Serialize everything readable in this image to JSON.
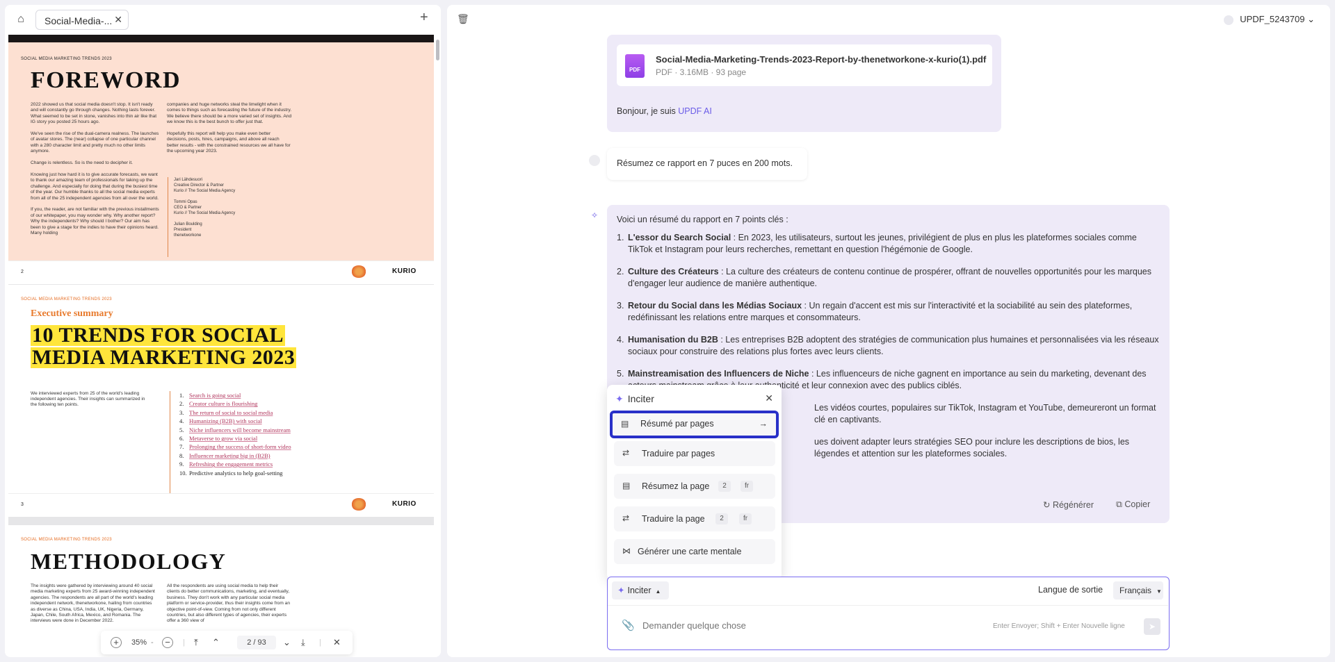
{
  "left_panel": {
    "tab_label": "Social-Media-...",
    "zoom": "35%",
    "page_current": "2",
    "page_total": "93"
  },
  "pdf": {
    "page1": {
      "runner": "SOCIAL MEDIA MARKETING TRENDS 2023",
      "title": "FOREWORD",
      "col1": "2022 showed us that social media doesn't stop. It isn't ready and will constantly go through changes. Nothing lasts forever. What seemed to be set in stone, vanishes into thin air like that IG story you posted 25 hours ago.\n\nWe've seen the rise of the dual-camera realness. The launches of avatar stores. The (near) collapse of one particular channel with a 280 character limit and pretty much no other limits anymore.\n\nChange is relentless. So is the need to decipher it.\n\nKnowing just how hard it is to give accurate forecasts, we want to thank our amazing team of professionals for taking up the challenge. And especially for doing that during the busiest time of the year. Our humble thanks to all the social media experts from all of the 25 independent agencies from all over the world.\n\nIf you, the reader, are not familiar with the previous installments of our whitepaper, you may wonder why. Why another report? Why the independents? Why should I bother? Our aim has been to give a stage for the indies to have their opinions heard. Many holding",
      "col2": "companies and huge networks steal the limelight when it comes to things such as forecasting the future of the industry. We believe there should be a more varied set of insights. And we know this is the best bunch to offer just that.\n\nHopefully this report will help you make even better decisions, posts, hires, campaigns, and above all reach better results - with the constrained resources we all have for the upcoming year 2023.",
      "signatures": "Jari Lähdesuori\nCreative Director & Partner\nKurio // The Social Media Agency\n\nTommi Opas\nCEO & Partner\nKurio // The Social Media Agency\n\nJulian Boulding\nPresident\nthenetworkone",
      "page_number": "2",
      "logo": "KURIO"
    },
    "page2": {
      "runner": "SOCIAL MEDIA MARKETING TRENDS 2023",
      "kicker": "Executive summary",
      "title_line1": "10 TRENDS FOR SOCIAL",
      "title_line2": "MEDIA MARKETING 2023",
      "intro": "We interviewed experts from 25 of the world's leading independent agencies. Their insights can summarized in the following ten points.",
      "trends": [
        {
          "n": "1.",
          "t": "Search is going social"
        },
        {
          "n": "2.",
          "t": "Creator culture is flourishing"
        },
        {
          "n": "3.",
          "t": "The return of social to social media"
        },
        {
          "n": "4.",
          "t": "Humanizing (B2B) with social"
        },
        {
          "n": "5.",
          "t": "Niche influencers will become mainstream"
        },
        {
          "n": "6.",
          "t": "Metaverse to grow via social"
        },
        {
          "n": "7.",
          "t": "Prolonging the success of short-form video"
        },
        {
          "n": "8.",
          "t": "Influencer marketing big in (B2B)"
        },
        {
          "n": "9.",
          "t": "Refreshing the engagement metrics"
        },
        {
          "n": "10.",
          "t": "Predictive analytics to help goal-setting"
        }
      ],
      "page_number": "3",
      "logo": "KURIO"
    },
    "page3": {
      "runner": "SOCIAL MEDIA MARKETING TRENDS 2023",
      "title": "METHODOLOGY",
      "col1": "The insights were gathered by interviewing around 40 social media marketing experts from 25 award-winning independent agencies. The respondents are all part of the world's leading independent network, thenetworkone, hailing from countries as diverse as China, USA, India, UK, Nigeria, Germany, Japan, Chile, South Africa, Mexico, and Romania. The interviews were done in December 2022.",
      "col2": "All the respondents are using social media to help their clients do better communications, marketing, and eventually, business. They don't work with any particular social media platform or service-provider, thus their insights come from an objective point-of-view. Coming from not only different countries, but also different types of agencies, their experts offer a 360 view of"
    }
  },
  "right_panel": {
    "user_name": "UPDF_5243709",
    "file": {
      "name": "Social-Media-Marketing-Trends-2023-Report-by-thenetworkone-x-kurio(1).pdf",
      "meta": "PDF · 3.16MB · 93 page",
      "icon_label": "PDF"
    },
    "greeting_prefix": "Bonjour, je suis ",
    "greeting_brand": "UPDF AI",
    "user_message": "Résumez ce rapport en 7 puces en 200 mots.",
    "ai_intro": "Voici un résumé du rapport en 7 points clés :",
    "points": [
      {
        "num": "1.",
        "bold": "L'essor du Search Social",
        "text": " : En 2023, les utilisateurs, surtout les jeunes, privilégient de plus en plus les plateformes sociales comme TikTok et Instagram pour leurs recherches, remettant en question l'hégémonie de Google."
      },
      {
        "num": "2.",
        "bold": "Culture des Créateurs",
        "text": " : La culture des créateurs de contenu continue de prospérer, offrant de nouvelles opportunités pour les marques d'engager leur audience de manière authentique."
      },
      {
        "num": "3.",
        "bold": "Retour du Social dans les Médias Sociaux",
        "text": " : Un regain d'accent est mis sur l'interactivité et la sociabilité au sein des plateformes, redéfinissant les relations entre marques et consommateurs."
      },
      {
        "num": "4.",
        "bold": "Humanisation du B2B",
        "text": " : Les entreprises B2B adoptent des stratégies de communication plus humaines et personnalisées via les réseaux sociaux pour construire des relations plus fortes avec leurs clients."
      },
      {
        "num": "5.",
        "bold": "Mainstreamisation des Influencers de Niche",
        "text": " : Les influenceurs de niche gagnent en importance au sein du marketing, devenant des acteurs mainstream grâce à leur authenticité et leur connexion avec des publics ciblés."
      },
      {
        "num": "6.",
        "bold": "",
        "text": "Les vidéos courtes, populaires sur TikTok, Instagram et YouTube, demeureront un format clé en captivants."
      },
      {
        "num": "7.",
        "bold": "",
        "text": "ues doivent adapter leurs stratégies SEO pour inclure les descriptions de bios, les légendes et attention sur les plateformes sociales."
      }
    ],
    "regenerate_label": "Régénérer",
    "copy_label": "Copier",
    "popup": {
      "title": "Inciter",
      "items": [
        {
          "label": "Résumé par pages",
          "arrow": "→"
        },
        {
          "label": "Traduire par pages"
        },
        {
          "label": "Résumez la page",
          "tag1": "2",
          "tag2": "fr"
        },
        {
          "label": "Traduire la page",
          "tag1": "2",
          "tag2": "fr"
        },
        {
          "label": "Générer une carte mentale"
        }
      ]
    },
    "composer": {
      "prompt_button": "Inciter",
      "output_lang_label": "Langue de sortie",
      "output_lang_value": "Français",
      "placeholder": "Demander quelque chose",
      "hint": "Enter Envoyer; Shift + Enter Nouvelle ligne"
    }
  },
  "colors": {
    "accent": "#7a6cf0",
    "selection_border": "#2830c8",
    "highlight_yellow": "#ffe53b",
    "foreword_bg": "#fde0d2"
  },
  "icons": [
    "home-icon",
    "close-icon",
    "plus-icon",
    "trash-icon",
    "pdf-file-icon",
    "sparkle-icon",
    "document-list-icon",
    "translate-icon",
    "mindmap-icon",
    "regenerate-icon",
    "copy-icon",
    "paperclip-icon",
    "send-icon",
    "zoom-in-icon",
    "zoom-out-icon"
  ]
}
